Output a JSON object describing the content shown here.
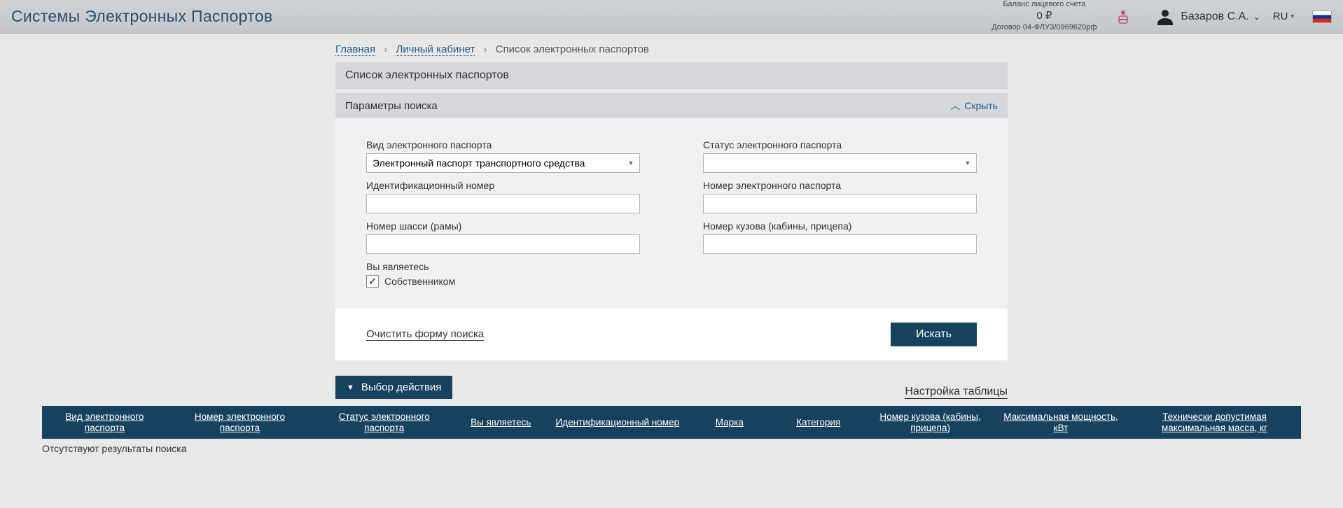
{
  "header": {
    "site_title": "Системы Электронных Паспортов",
    "balance_label": "Баланс лицевого счета",
    "balance_amount": "0 ₽",
    "contract": "Договор 04-ФЛУЗ/0969620рф",
    "user_name": "Базаров С.А.",
    "lang": "RU"
  },
  "breadcrumb": {
    "home": "Главная",
    "lk": "Личный кабинет",
    "current": "Список электронных паспортов"
  },
  "page_title": "Список электронных паспортов",
  "search_panel": {
    "title": "Параметры поиска",
    "hide": "Скрыть",
    "labels": {
      "type": "Вид электронного паспорта",
      "status": "Статус электронного паспорта",
      "id_num": "Идентификационный номер",
      "pass_num": "Номер электронного паспорта",
      "chassis": "Номер шасси (рамы)",
      "body": "Номер кузова (кабины, прицепа)",
      "you_are": "Вы являетесь"
    },
    "values": {
      "type": "Электронный паспорт транспортного средства",
      "status": "",
      "id_num": "",
      "pass_num": "",
      "chassis": "",
      "body": "",
      "owner_checkbox": "Собственником",
      "owner_checked": true
    },
    "clear": "Очистить форму поиска",
    "search": "Искать"
  },
  "action_bar": {
    "choose_action": "Выбор действия",
    "table_settings": "Настройка таблицы"
  },
  "table": {
    "columns": [
      "Вид электронного паспорта",
      "Номер электронного паспорта",
      "Статус электронного паспорта",
      "Вы являетесь",
      "Идентификационный номер",
      "Марка",
      "Категория",
      "Номер кузова (кабины, прицепа)",
      "Максимальная мощность, кВт",
      "Технически допустимая максимальная масса, кг"
    ],
    "no_results": "Отсутствуют результаты поиска"
  }
}
